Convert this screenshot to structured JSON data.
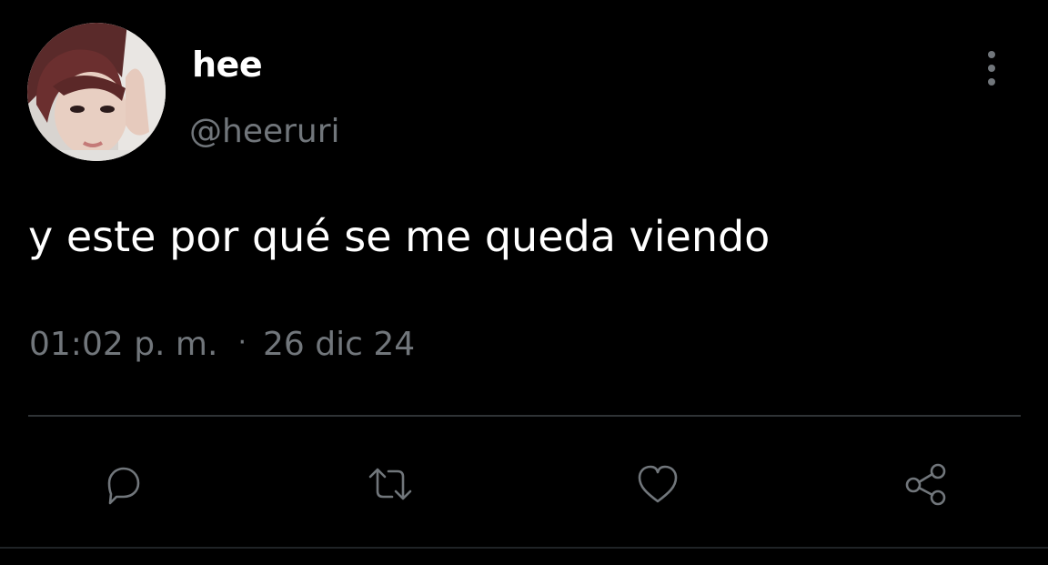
{
  "tweet": {
    "author": {
      "display_name": "hee",
      "handle": "@heeruri"
    },
    "text": "y este por qué se me queda viendo",
    "time": "01:02 p. m.",
    "separator": "·",
    "date": "26 dic 24"
  },
  "icons": {
    "more": "more-vertical-icon",
    "reply": "reply-icon",
    "retweet": "retweet-icon",
    "like": "heart-icon",
    "share": "share-icon"
  },
  "colors": {
    "background": "#000000",
    "primary_text": "#ffffff",
    "secondary_text": "#71767b",
    "divider": "#2f3336"
  }
}
